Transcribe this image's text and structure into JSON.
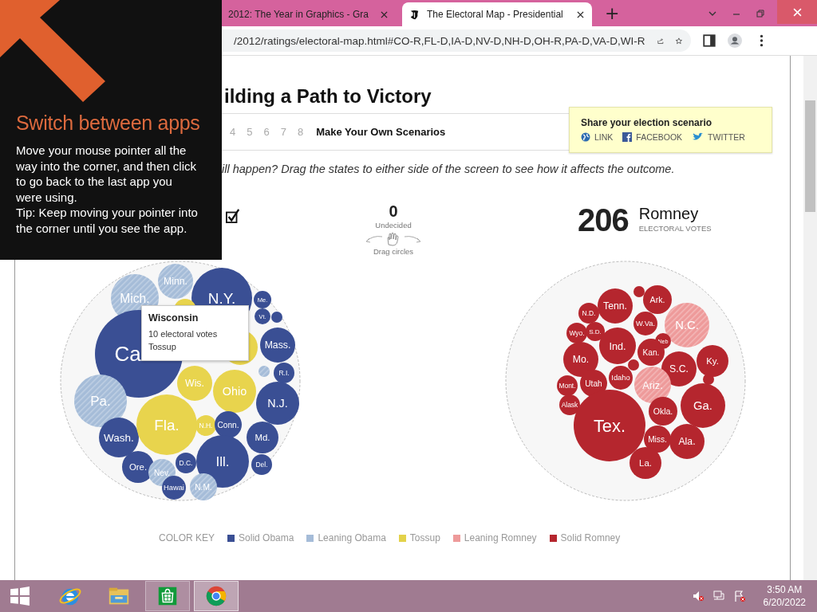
{
  "browser": {
    "tabs": [
      {
        "title": "2012: The Year in Graphics - Gra",
        "selected": false
      },
      {
        "title": "The Electoral Map - Presidential",
        "selected": true
      }
    ],
    "new_tab": "+",
    "url": "/2012/ratings/electoral-map.html#CO-R,FL-D,IA-D,NV-D,NH-D,OH-R,PA-D,VA-D,WI-R"
  },
  "overlay": {
    "title": "Switch between apps",
    "body": "Move your mouse pointer all the way into the corner, and then click to go back to the last app you were using.",
    "tip": "Tip: Keep moving your pointer into the corner until you see the app."
  },
  "heading": "ilding a Path to Victory",
  "scenarios": [
    {
      "label": "4",
      "selected": false
    },
    {
      "label": "5",
      "selected": false
    },
    {
      "label": "6",
      "selected": false
    },
    {
      "label": "7",
      "selected": false
    },
    {
      "label": "8",
      "selected": false
    },
    {
      "label": "Make Your Own Scenarios",
      "selected": true
    }
  ],
  "share": {
    "title": "Share your election scenario",
    "links": [
      {
        "kind": "link",
        "label": "LINK"
      },
      {
        "kind": "facebook",
        "label": "FACEBOOK"
      },
      {
        "kind": "twitter",
        "label": "TWITTER"
      }
    ]
  },
  "instructions": "ill happen? Drag the states to either side of the screen to see how it affects the outcome.",
  "undecided": {
    "count": "0",
    "label": "Undecided",
    "hint": "Drag circles"
  },
  "romney": {
    "count": "206",
    "name": "Romney",
    "label": "ELECTORAL VOTES"
  },
  "obama_bubbles": [
    {
      "label": "Mich.",
      "color": "#a5bcd8",
      "leaning": true
    },
    {
      "label": "Minn.",
      "color": "#a5bcd8",
      "leaning": true
    },
    {
      "label": "N.Y.",
      "color": "#3a4f94",
      "leaning": false
    },
    {
      "label": "Me.",
      "color": "#3a4f94",
      "leaning": false
    },
    {
      "label": "Vt.",
      "color": "#3a4f94",
      "leaning": false
    },
    {
      "color": "#3a4f94",
      "leaning": false
    },
    {
      "label": "Ca",
      "color": "#3a4f94",
      "leaning": false
    },
    {
      "color": "#e8d44d",
      "leaning": false
    },
    {
      "color": "#e8d44d",
      "leaning": false
    },
    {
      "label": "Mass.",
      "color": "#3a4f94",
      "leaning": false
    },
    {
      "color": "#a5bcd8",
      "leaning": true
    },
    {
      "label": "R.I.",
      "color": "#3a4f94",
      "leaning": false
    },
    {
      "label": "Pa.",
      "color": "#a5bcd8",
      "leaning": true
    },
    {
      "label": "Wis.",
      "color": "#e8d44d",
      "leaning": false
    },
    {
      "label": "Ohio",
      "color": "#e8d44d",
      "leaning": false
    },
    {
      "label": "N.J.",
      "color": "#3a4f94",
      "leaning": false
    },
    {
      "label": "Wash.",
      "color": "#3a4f94",
      "leaning": false
    },
    {
      "label": "Fla.",
      "color": "#e8d44d",
      "leaning": false
    },
    {
      "label": "N.H.",
      "color": "#e8d44d",
      "leaning": false
    },
    {
      "label": "Conn.",
      "color": "#3a4f94",
      "leaning": false
    },
    {
      "label": "Md.",
      "color": "#3a4f94",
      "leaning": false
    },
    {
      "label": "Ore.",
      "color": "#3a4f94",
      "leaning": false
    },
    {
      "label": "Nev.",
      "color": "#a5bcd8",
      "leaning": true
    },
    {
      "label": "D.C.",
      "color": "#3a4f94",
      "leaning": false
    },
    {
      "label": "Ill.",
      "color": "#3a4f94",
      "leaning": false
    },
    {
      "label": "Del.",
      "color": "#3a4f94",
      "leaning": false
    },
    {
      "label": "Hawai",
      "color": "#3a4f94",
      "leaning": false
    },
    {
      "label": "N.M.",
      "color": "#a5bcd8",
      "leaning": true
    }
  ],
  "romney_bubbles": [
    {
      "label": "N.D.",
      "color": "#b5262e",
      "leaning": false
    },
    {
      "label": "Tenn.",
      "color": "#b5262e",
      "leaning": false
    },
    {
      "color": "#b5262e",
      "leaning": false
    },
    {
      "label": "Ark.",
      "color": "#b5262e",
      "leaning": false
    },
    {
      "label": "W.Va.",
      "color": "#b5262e",
      "leaning": false
    },
    {
      "label": "N.C.",
      "color": "#ee9a9a",
      "leaning": true
    },
    {
      "label": "Wyo.",
      "color": "#b5262e",
      "leaning": false
    },
    {
      "label": "S.D.",
      "color": "#b5262e",
      "leaning": false
    },
    {
      "label": "Ind.",
      "color": "#b5262e",
      "leaning": false
    },
    {
      "label": "Neb",
      "color": "#b5262e",
      "leaning": false
    },
    {
      "label": "Mo.",
      "color": "#b5262e",
      "leaning": false
    },
    {
      "label": "Kan.",
      "color": "#b5262e",
      "leaning": false
    },
    {
      "label": "S.C.",
      "color": "#b5262e",
      "leaning": false
    },
    {
      "label": "Ky.",
      "color": "#b5262e",
      "leaning": false
    },
    {
      "color": "#b5262e",
      "leaning": false
    },
    {
      "label": "Mont.",
      "color": "#b5262e",
      "leaning": false
    },
    {
      "label": "Utah",
      "color": "#b5262e",
      "leaning": false
    },
    {
      "label": "Idaho",
      "color": "#b5262e",
      "leaning": false
    },
    {
      "label": "Ariz.",
      "color": "#ee9a9a",
      "leaning": true
    },
    {
      "color": "#b5262e",
      "leaning": false
    },
    {
      "label": "Alask",
      "color": "#b5262e",
      "leaning": false
    },
    {
      "label": "Ga.",
      "color": "#b5262e",
      "leaning": false
    },
    {
      "label": "Okla.",
      "color": "#b5262e",
      "leaning": false
    },
    {
      "label": "Tex.",
      "color": "#b5262e",
      "leaning": false
    },
    {
      "label": "Miss.",
      "color": "#b5262e",
      "leaning": false
    },
    {
      "label": "Ala.",
      "color": "#b5262e",
      "leaning": false
    },
    {
      "label": "La.",
      "color": "#b5262e",
      "leaning": false
    }
  ],
  "tooltip": {
    "title": "Wisconsin",
    "votes": "10 electoral votes",
    "rating": "Tossup"
  },
  "color_key": {
    "title": "COLOR KEY",
    "items": [
      {
        "label": "Solid Obama",
        "color": "#3a4f94"
      },
      {
        "label": "Leaning Obama",
        "color": "#a5bcd8"
      },
      {
        "label": "Tossup",
        "color": "#e3d24a"
      },
      {
        "label": "Leaning Romney",
        "color": "#ee9a9a"
      },
      {
        "label": "Solid Romney",
        "color": "#b5262e"
      }
    ]
  },
  "taskbar": {
    "apps": [
      {
        "kind": "ie",
        "running": false,
        "selected": false
      },
      {
        "kind": "explorer",
        "running": false,
        "selected": false
      },
      {
        "kind": "store",
        "running": true,
        "selected": false
      },
      {
        "kind": "chrome",
        "running": true,
        "selected": true
      }
    ],
    "time": "3:50 AM",
    "date": "6/20/2022"
  }
}
